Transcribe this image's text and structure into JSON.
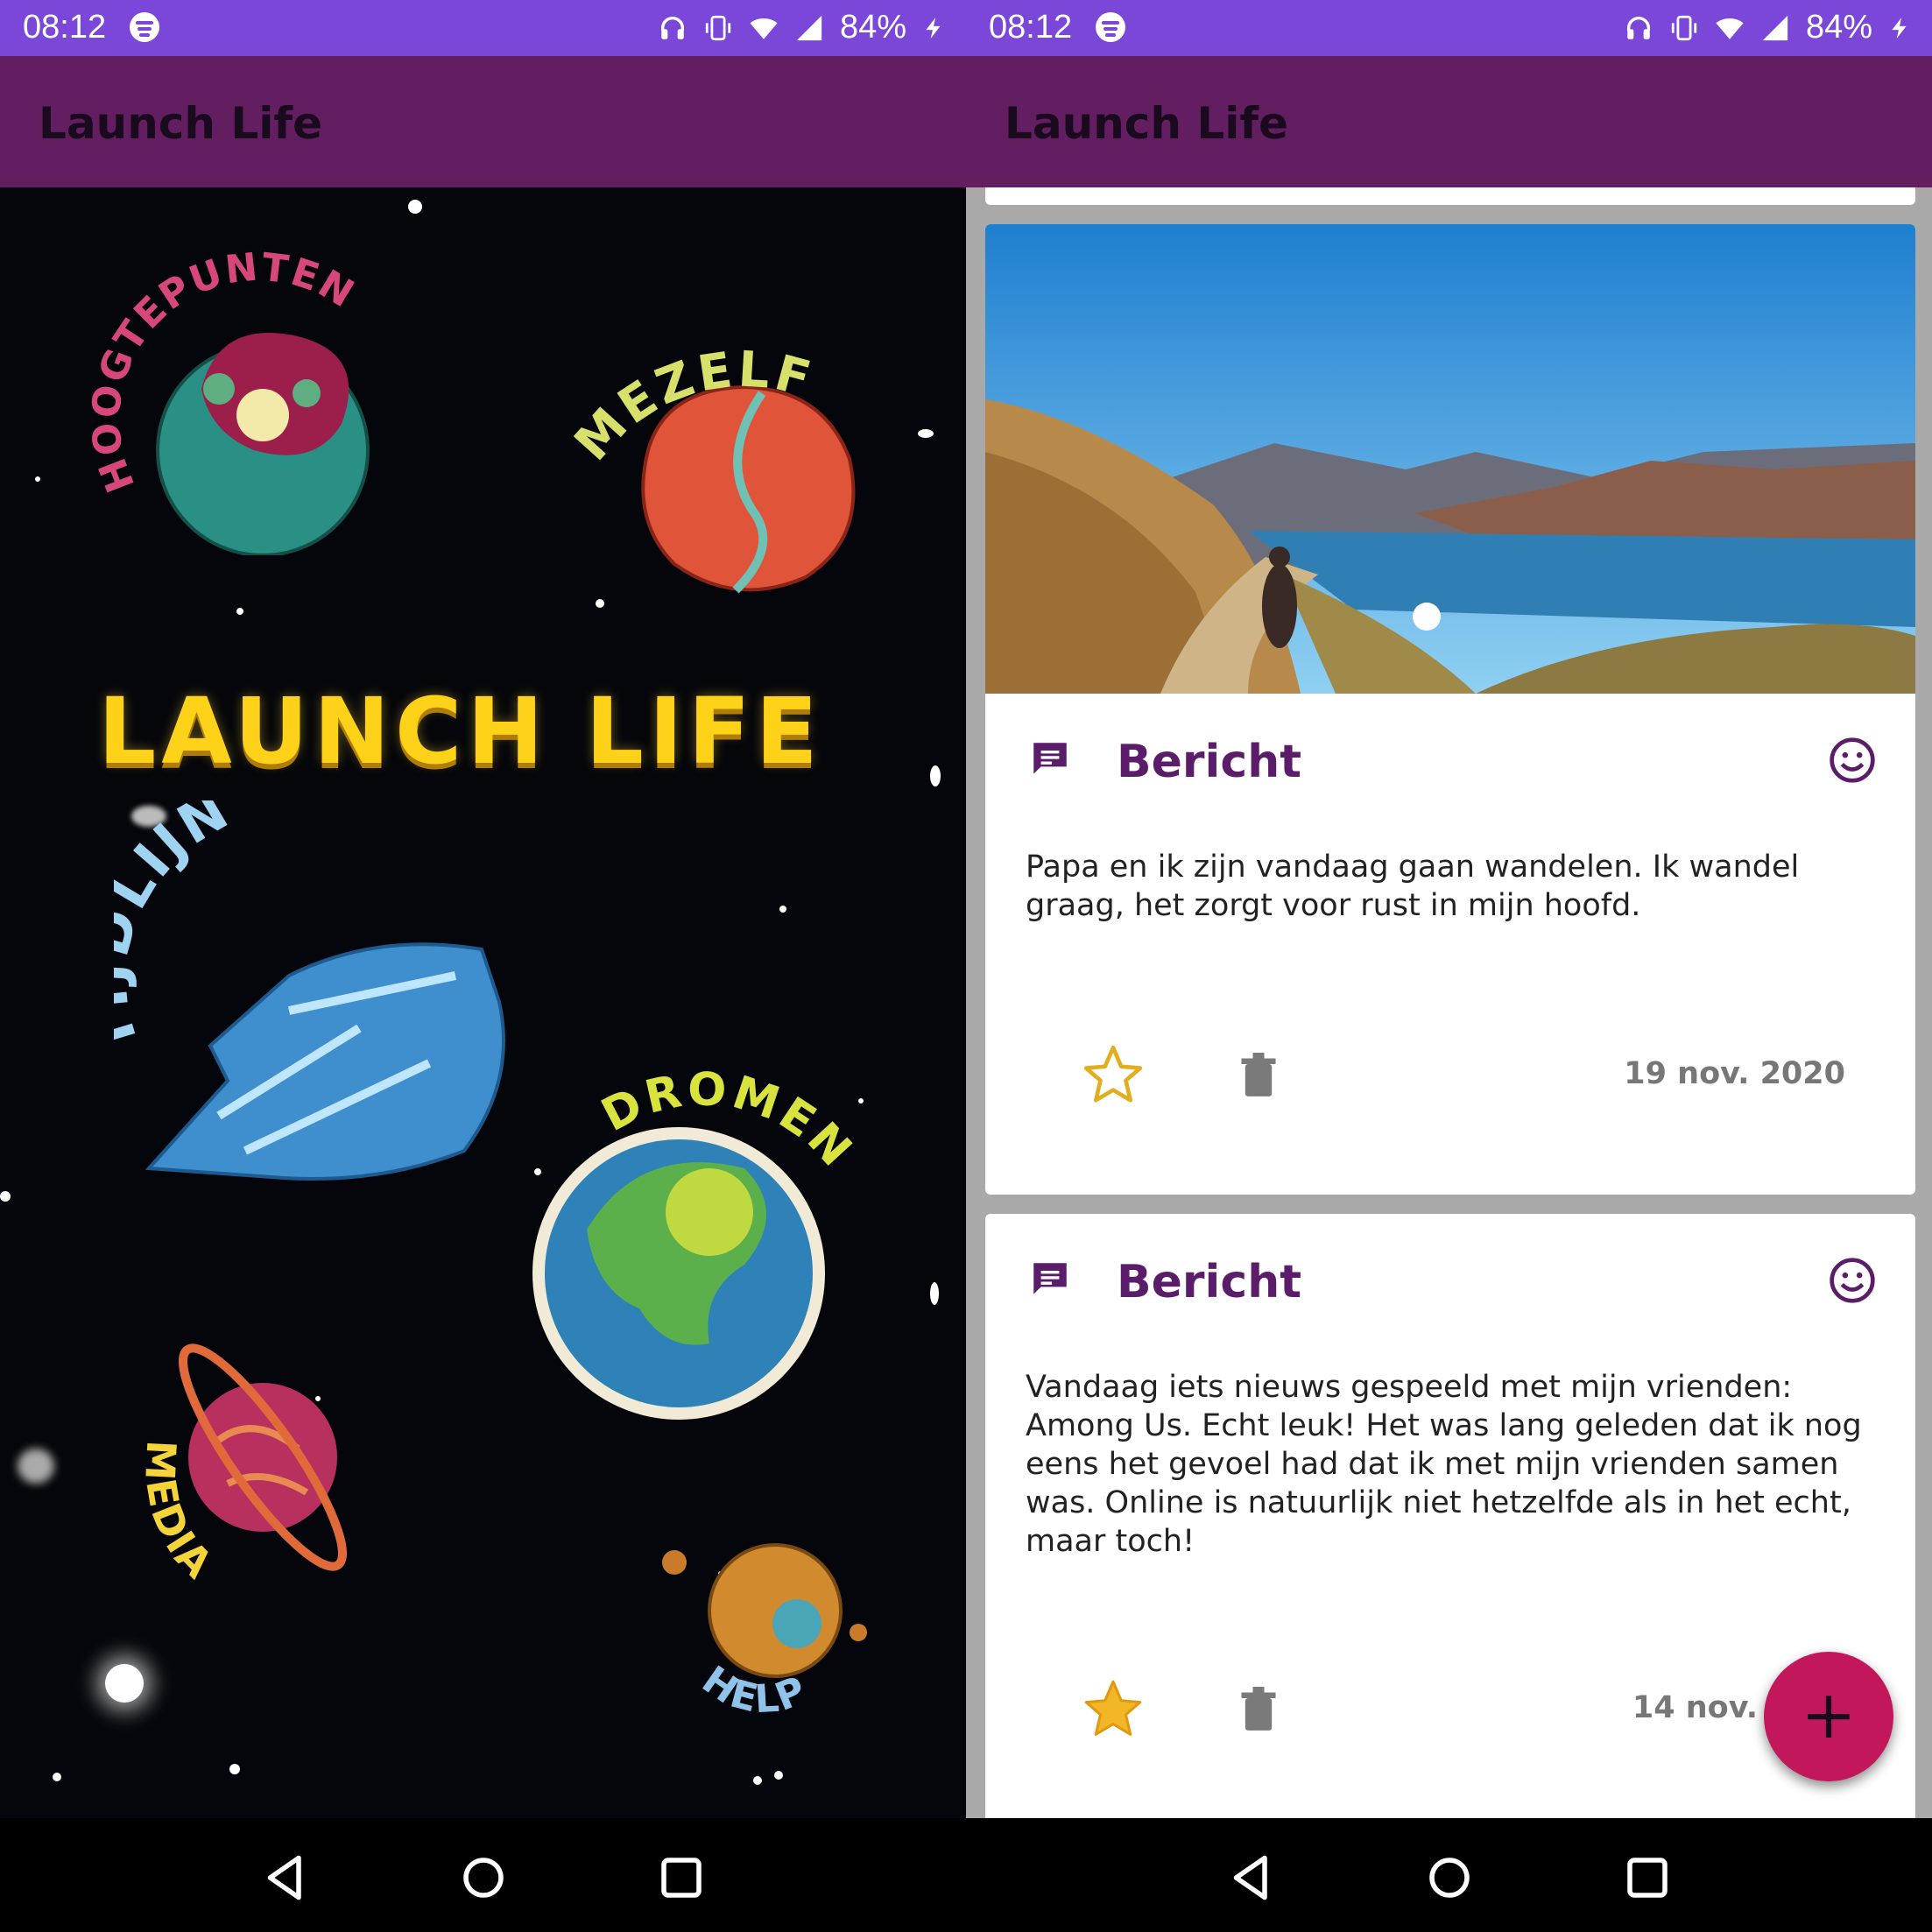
{
  "status_bar": {
    "time": "08:12",
    "battery": "84%",
    "icons": [
      "spotify-icon",
      "headphones-icon",
      "vibrate-icon",
      "wifi-icon",
      "signal-icon",
      "charging-icon"
    ]
  },
  "app_bar": {
    "title": "Launch Life"
  },
  "home": {
    "logo": "LAUNCH LIFE",
    "menu": [
      {
        "label": "HOOGTEPUNTEN",
        "icon": "planet-crater-icon"
      },
      {
        "label": "MEZELF",
        "icon": "planet-red-icon"
      },
      {
        "label": "TIJDLIJN",
        "icon": "planet-ice-icon"
      },
      {
        "label": "DROMEN",
        "icon": "planet-earth-icon"
      },
      {
        "label": "MEDIA",
        "icon": "planet-ringed-icon"
      },
      {
        "label": "HELP",
        "icon": "planet-help-icon"
      }
    ]
  },
  "feed": {
    "posts": [
      {
        "type": "Bericht",
        "text": "Papa en ik zijn vandaag gaan wandelen. Ik wandel\ngraag, het zorgt voor rust in mijn hoofd.",
        "date": "19 nov. 2020",
        "favorite": false,
        "mood_icon": "smiley-icon",
        "photo": "mountain-lake-photo"
      },
      {
        "type": "Bericht",
        "text": "Vandaag iets nieuws gespeeld met mijn vrienden:\nAmong Us. Echt leuk! Het was lang geleden dat ik nog\neens het gevoel had dat ik met mijn vrienden samen\nwas. Online is natuurlijk niet hetzelfde als in het echt,\nmaar toch!",
        "date": "14 nov.",
        "favorite": true,
        "mood_icon": "smiley-icon"
      }
    ],
    "fab": "+"
  },
  "colors": {
    "status": "#7b47d9",
    "appbar": "#631d61",
    "accent": "#5b1d6a",
    "fab": "#c2185b",
    "star": "#f2b626"
  }
}
